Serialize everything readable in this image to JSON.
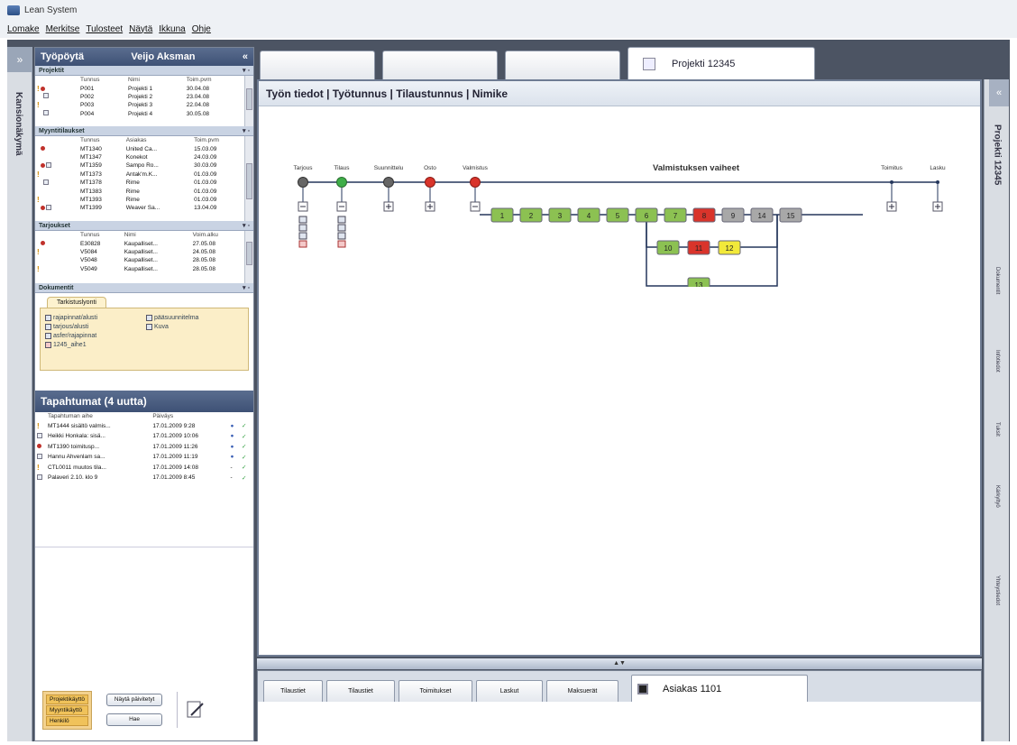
{
  "app": {
    "title": "Lean System"
  },
  "menu": [
    "Lomake",
    "Merkitse",
    "Tulosteet",
    "Näytä",
    "Ikkuna",
    "Ohje"
  ],
  "left_strip": {
    "arrow": "»",
    "label": "Kansionäkymä"
  },
  "left_panel": {
    "header_title": "Työpöytä",
    "header_user": "Veijo Aksman",
    "header_close": "«",
    "projects": {
      "title": "Projektit",
      "columns": [
        "Tunnus",
        "Nimi",
        "Toim.pvm"
      ],
      "rows": [
        {
          "id": "P001",
          "name": "Projekti 1",
          "date": "30.04.08"
        },
        {
          "id": "P002",
          "name": "Projekti 2",
          "date": "23.04.08"
        },
        {
          "id": "P003",
          "name": "Projekti 3",
          "date": "22.04.08"
        },
        {
          "id": "P004",
          "name": "Projekti 4",
          "date": "30.05.08"
        }
      ]
    },
    "sales_orders": {
      "title": "Myyntitilaukset",
      "columns": [
        "Tunnus",
        "Asiakas",
        "Toim.pvm"
      ],
      "rows": [
        {
          "id": "MT1340",
          "customer": "United Ca...",
          "date": "15.03.09"
        },
        {
          "id": "MT1347",
          "customer": "Konekot",
          "date": "24.03.09"
        },
        {
          "id": "MT1359",
          "customer": "Sampo Ro...",
          "date": "30.03.09"
        },
        {
          "id": "MT1373",
          "customer": "Antak'm.K...",
          "date": "01.03.09"
        },
        {
          "id": "MT1378",
          "customer": "Rime",
          "date": "01.03.09"
        },
        {
          "id": "MT1383",
          "customer": "Rime",
          "date": "01.03.09"
        },
        {
          "id": "MT1393",
          "customer": "Rime",
          "date": "01.03.09"
        },
        {
          "id": "MT1399",
          "customer": "Weaver Sa...",
          "date": "13.04.09"
        }
      ]
    },
    "offers": {
      "title": "Tarjoukset",
      "columns": [
        "Tunnus",
        "Nimi",
        "Voim.alku"
      ],
      "rows": [
        {
          "id": "E30828",
          "name": "Kaupalliset...",
          "date": "27.05.08"
        },
        {
          "id": "V5084",
          "name": "Kaupalliset...",
          "date": "24.05.08"
        },
        {
          "id": "V5048",
          "name": "Kaupalliset...",
          "date": "28.05.08"
        },
        {
          "id": "V5049",
          "name": "Kaupalliset...",
          "date": "28.05.08"
        }
      ]
    },
    "documents": {
      "title": "Dokumentit",
      "tab": "Tarkistuslyonti",
      "left": [
        "rajapinnat/alusti",
        "tarjous/alusti",
        "asfer/rajapinnat",
        "1245_aihe1"
      ],
      "right": [
        "pääsuunnitelma",
        "Kuva"
      ]
    },
    "events": {
      "title": "Tapahtumat (4 uutta)",
      "columns": [
        "Tapahtuman aihe",
        "Päiväys"
      ],
      "rows": [
        {
          "subject": "MT1444 sisältö valmis...",
          "date": "17.01.2009 9:28"
        },
        {
          "subject": "Heikki Honkala: sisä...",
          "date": "17.01.2009 10:06"
        },
        {
          "subject": "MT1390 toimitusp...",
          "date": "17.01.2009 11:26"
        },
        {
          "subject": "Hannu Ahvenlam sa...",
          "date": "17.01.2009 11:19"
        },
        {
          "subject": "CTL0011 muutos tila...",
          "date": "17.01.2009 14:08"
        },
        {
          "subject": "Palaveri 2.10. klo 9",
          "date": "17.01.2009 8:45"
        }
      ]
    },
    "footer": {
      "stack": [
        "Projektikäyttö",
        "Myyntikäyttö",
        "Henkilö"
      ],
      "show_more": "Näytä päivitetyt",
      "close": "Hae"
    }
  },
  "top_tabs": {
    "active_label": "Projekti 12345"
  },
  "main": {
    "header": "Työn tiedot | Työtunnus | Tilaustunnus | Nimike",
    "phases_title": "Valmistuksen vaiheet",
    "stage_labels": [
      "Tarjous",
      "Tilaus",
      "Suunnittelu",
      "Osto",
      "Valmistus",
      "Toimitus",
      "Lasku"
    ],
    "steps": [
      "1",
      "2",
      "3",
      "4",
      "5",
      "6",
      "7",
      "8",
      "9",
      "14",
      "15",
      "10",
      "11",
      "12",
      "13"
    ]
  },
  "divider": {
    "label": "▲▼"
  },
  "bottom_tabs": [
    "Tilaustiet",
    "Tilaustiet",
    "Toimitukset",
    "Laskut",
    "Maksuerät"
  ],
  "bottom_active": "Asiakas 1101",
  "right_strip": {
    "arrow": "«",
    "main_label": "Projekti 12345",
    "tabs": [
      "Dokumentit",
      "Infotiedot",
      "Tuksit",
      "Kärkyltyö",
      "Yhteystiedot"
    ]
  },
  "colors": {
    "panel_header": "#4a5d80",
    "step_green": "#8cc152",
    "step_gray": "#a8a8a8",
    "step_red": "#d9342b",
    "step_yellow": "#f2e93a",
    "line_blue": "#25375c",
    "docs_yellow": "#fbeec8"
  }
}
